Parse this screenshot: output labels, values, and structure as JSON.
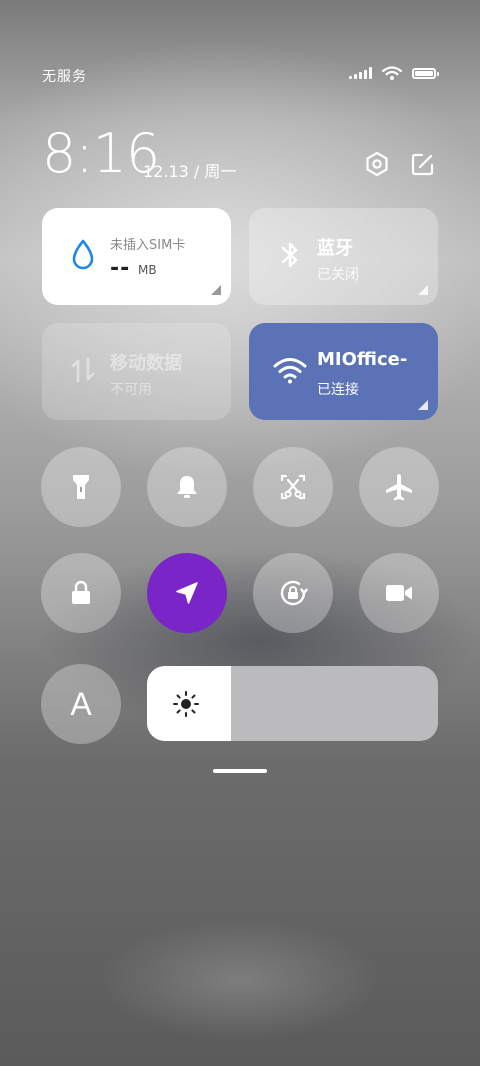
{
  "status_bar": {
    "carrier": "无服务",
    "icons": [
      "signal-icon",
      "wifi-icon",
      "battery-icon"
    ]
  },
  "header": {
    "time": "8:16",
    "date": "12.13 / 周一",
    "buttons": [
      "settings-icon",
      "edit-icon"
    ]
  },
  "tiles": {
    "data_usage": {
      "label": "未插入SIM卡",
      "value": "--",
      "unit": "MB",
      "icon": "water-drop-icon"
    },
    "bluetooth": {
      "title": "蓝牙",
      "status": "已关闭",
      "icon": "bluetooth-icon"
    },
    "mobile_data": {
      "title": "移动数据",
      "status": "不可用",
      "icon": "data-arrows-icon"
    },
    "wifi": {
      "title": "MIOffice-",
      "status": "已连接",
      "icon": "wifi-icon"
    }
  },
  "toggles_row1": [
    "flashlight-icon",
    "bell-icon",
    "screenshot-icon",
    "airplane-icon"
  ],
  "toggles_row2": [
    "lock-icon",
    "location-icon",
    "rotation-lock-icon",
    "video-icon"
  ],
  "auto_brightness_label": "A",
  "brightness": {
    "level": 0.29,
    "icon": "sun-icon"
  },
  "colors": {
    "wifi_tile": "#5b73b6",
    "location_active": "#7a25c8",
    "accent_drop": "#1e88e5"
  }
}
